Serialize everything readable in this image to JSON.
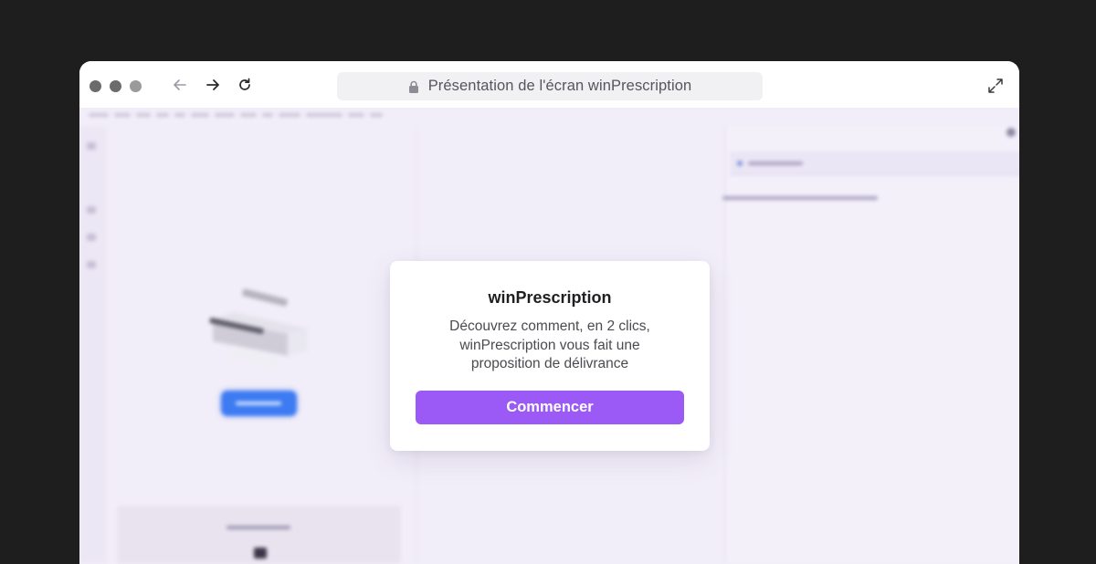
{
  "browser": {
    "url_title": "Présentation de l'écran winPrescription",
    "icons": {
      "back": "arrow-left-icon",
      "forward": "arrow-right-icon",
      "reload": "reload-icon",
      "lock": "lock-icon",
      "expand": "expand-icon"
    }
  },
  "dialog": {
    "title": "winPrescription",
    "body": "Découvrez comment, en 2 clics, winPrescription vous fait une proposition de délivrance",
    "button_label": "Commencer"
  },
  "colors": {
    "background": "#1e1e1e",
    "app_background": "#f2eef9",
    "accent": "#9b59f5",
    "blurred_button": "#3d7bf2"
  }
}
